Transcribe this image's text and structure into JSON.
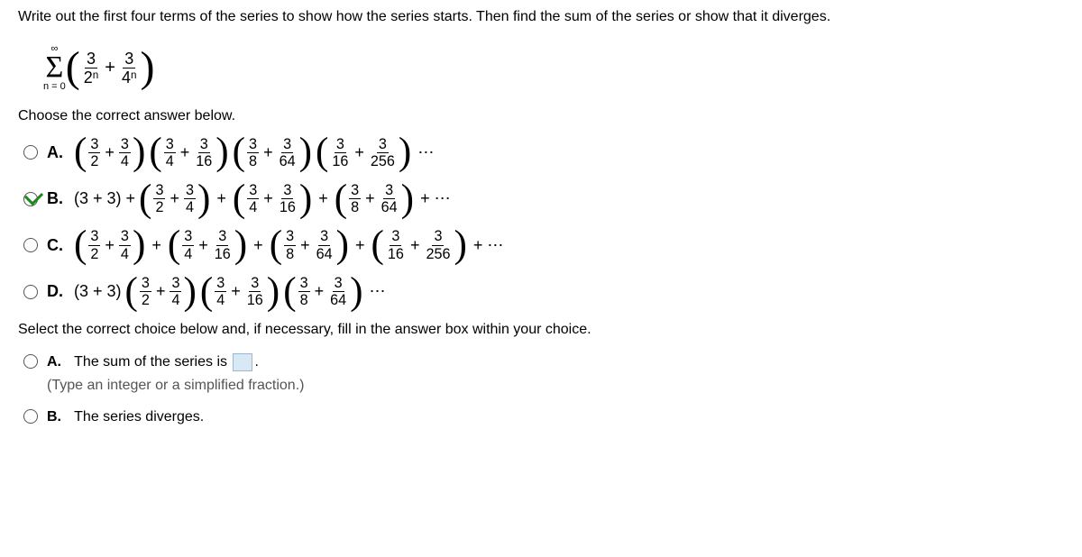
{
  "instruction": "Write out the first four terms of the series to show how the series starts. Then find the sum of the series or show that it diverges.",
  "series": {
    "sigma_top": "∞",
    "sigma_bottom": "n = 0",
    "term1_num": "3",
    "term1_den_base": "2",
    "term1_den_exp": "n",
    "plus": "+",
    "term2_num": "3",
    "term2_den_base": "4",
    "term2_den_exp": "n"
  },
  "prompt1": "Choose the correct answer below.",
  "options": {
    "A": {
      "label": "A.",
      "g1": {
        "a": "3",
        "b": "2",
        "c": "3",
        "d": "4"
      },
      "g2": {
        "a": "3",
        "b": "4",
        "c": "3",
        "d": "16"
      },
      "g3": {
        "a": "3",
        "b": "8",
        "c": "3",
        "d": "64"
      },
      "g4": {
        "a": "3",
        "b": "16",
        "c": "3",
        "d": "256"
      },
      "tail": "⋯"
    },
    "B": {
      "label": "B.",
      "lead": "(3 + 3) +",
      "g1": {
        "a": "3",
        "b": "2",
        "c": "3",
        "d": "4"
      },
      "g2": {
        "a": "3",
        "b": "4",
        "c": "3",
        "d": "16"
      },
      "g3": {
        "a": "3",
        "b": "8",
        "c": "3",
        "d": "64"
      },
      "tail": "+ ⋯"
    },
    "C": {
      "label": "C.",
      "g1": {
        "a": "3",
        "b": "2",
        "c": "3",
        "d": "4"
      },
      "g2": {
        "a": "3",
        "b": "4",
        "c": "3",
        "d": "16"
      },
      "g3": {
        "a": "3",
        "b": "8",
        "c": "3",
        "d": "64"
      },
      "g4": {
        "a": "3",
        "b": "16",
        "c": "3",
        "d": "256"
      },
      "tail": "+ ⋯"
    },
    "D": {
      "label": "D.",
      "lead": "(3 + 3)",
      "g1": {
        "a": "3",
        "b": "2",
        "c": "3",
        "d": "4"
      },
      "g2": {
        "a": "3",
        "b": "4",
        "c": "3",
        "d": "16"
      },
      "g3": {
        "a": "3",
        "b": "8",
        "c": "3",
        "d": "64"
      },
      "tail": "⋯"
    }
  },
  "prompt2": "Select the correct choice below and, if necessary, fill in the answer box within your choice.",
  "followup": {
    "A": {
      "label": "A.",
      "text_before": "The sum of the series is",
      "period": ".",
      "hint": "(Type an integer or a simplified fraction.)"
    },
    "B": {
      "label": "B.",
      "text": "The series diverges."
    }
  },
  "plus": "+"
}
